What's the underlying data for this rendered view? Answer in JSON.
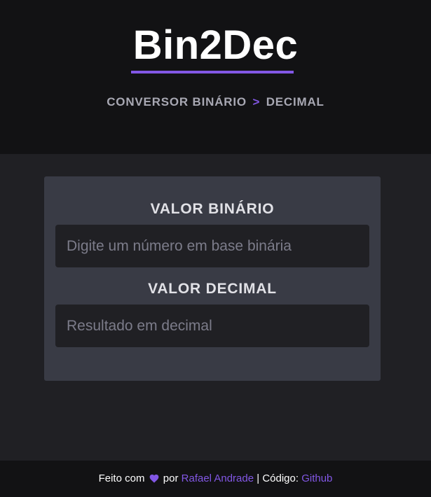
{
  "header": {
    "title": "Bin2Dec",
    "subtitle_part1": "CONVERSOR BINÁRIO",
    "subtitle_separator": ">",
    "subtitle_part2": "DECIMAL"
  },
  "form": {
    "binary_label": "VALOR BINÁRIO",
    "binary_placeholder": "Digite um número em base binária",
    "binary_value": "",
    "decimal_label": "VALOR DECIMAL",
    "decimal_placeholder": "Resultado em decimal",
    "decimal_value": ""
  },
  "footer": {
    "made_with": "Feito com",
    "heart_icon": "heart-icon",
    "by": "por",
    "author": "Rafael Andrade",
    "code_label": "| Código:",
    "code_link": "Github"
  },
  "colors": {
    "accent": "#8257e5",
    "header_bg": "#121214",
    "body_bg": "#202024",
    "card_bg": "#393b45",
    "input_bg": "#202024",
    "muted_text": "#a8a8b3"
  }
}
